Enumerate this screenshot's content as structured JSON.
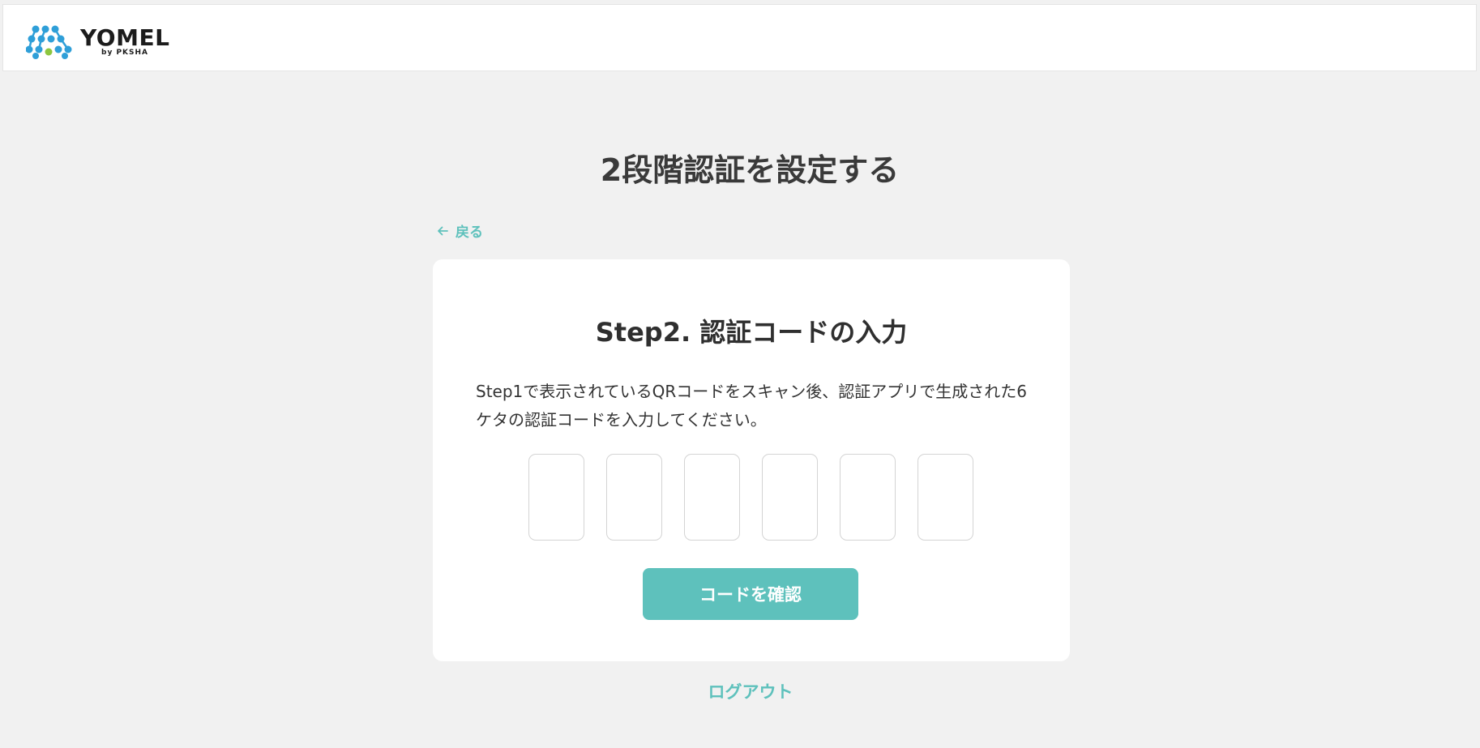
{
  "header": {
    "logo_word": "YOMEL",
    "logo_sub": "by PKSHA"
  },
  "page": {
    "title": "2段階認証を設定する",
    "back_label": "戻る"
  },
  "card": {
    "title": "Step2. 認証コードの入力",
    "description": "Step1で表示されているQRコードをスキャン後、認証アプリで生成された6ケタの認証コードを入力してください。",
    "code_inputs": [
      "",
      "",
      "",
      "",
      "",
      ""
    ],
    "confirm_label": "コードを確認"
  },
  "footer": {
    "logout_label": "ログアウト"
  },
  "colors": {
    "accent": "#5ec1bc",
    "background": "#f1f1f1",
    "card": "#ffffff",
    "logo_blue": "#2f9fd8",
    "logo_green": "#8dc63f"
  }
}
